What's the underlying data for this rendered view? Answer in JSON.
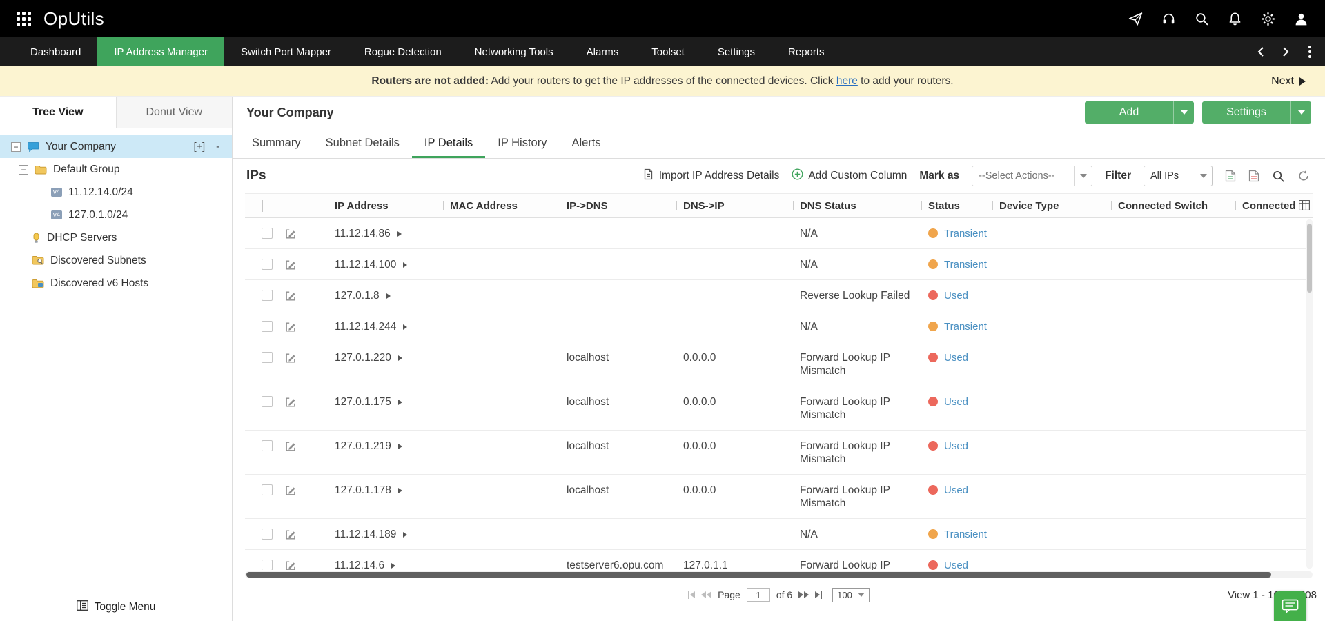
{
  "colors": {
    "accent_green": "#3fa45c",
    "button_green": "#53ae68",
    "banner_bg": "#fcf4d1",
    "tree_selected_bg": "#cde9f7",
    "status_link_text": "#4a90c2",
    "status": {
      "Transient": "#f0a54c",
      "Used": "#ec685c"
    }
  },
  "topbar": {
    "logo": "OpUtils",
    "icons": [
      "apps-grid-icon",
      "announcement-icon",
      "support-icon",
      "search-icon",
      "notifications-icon",
      "settings-gear-icon",
      "user-icon"
    ]
  },
  "nav": {
    "items": [
      {
        "label": "Dashboard"
      },
      {
        "label": "IP Address Manager",
        "active": true
      },
      {
        "label": "Switch Port Mapper"
      },
      {
        "label": "Rogue Detection"
      },
      {
        "label": "Networking Tools"
      },
      {
        "label": "Alarms"
      },
      {
        "label": "Toolset"
      },
      {
        "label": "Settings"
      },
      {
        "label": "Reports"
      }
    ]
  },
  "banner": {
    "bold": "Routers are not added:",
    "before_link": " Add your routers to get the IP addresses of the connected devices. Click ",
    "link": "here",
    "after_link": " to add your routers.",
    "next_label": "Next"
  },
  "sidebar": {
    "tabs": [
      {
        "label": "Tree View",
        "active": true
      },
      {
        "label": "Donut View"
      }
    ],
    "tree": [
      {
        "label": "Your Company",
        "icon": "company-icon"
      },
      {
        "label": "Default Group",
        "icon": "folder-icon"
      },
      {
        "label": "11.12.14.0/24",
        "icon": "v4-badge"
      },
      {
        "label": "127.0.1.0/24",
        "icon": "v4-badge"
      },
      {
        "label": "DHCP Servers",
        "icon": "dhcp-server-icon"
      },
      {
        "label": "Discovered Subnets",
        "icon": "folder-search-icon"
      },
      {
        "label": "Discovered v6 Hosts",
        "icon": "folder-v6-icon"
      }
    ],
    "tree_controls": {
      "add": "[+]",
      "remove": "-"
    },
    "toggle_menu": "Toggle Menu"
  },
  "main": {
    "title": "Your Company",
    "add_button": "Add",
    "settings_button": "Settings",
    "tabs": [
      {
        "label": "Summary"
      },
      {
        "label": "Subnet Details"
      },
      {
        "label": "IP Details",
        "active": true
      },
      {
        "label": "IP History"
      },
      {
        "label": "Alerts"
      }
    ],
    "section_title": "IPs",
    "toolbar": {
      "import_label": "Import IP Address Details",
      "add_column_label": "Add Custom Column",
      "mark_as_label": "Mark as",
      "actions_dropdown": "--Select Actions--",
      "filter_label": "Filter",
      "filter_dropdown": "All IPs",
      "icons": [
        "export-csv-icon",
        "export-pdf-icon",
        "search-icon",
        "refresh-icon"
      ]
    },
    "table": {
      "columns": [
        "IP Address",
        "MAC Address",
        "IP->DNS",
        "DNS->IP",
        "DNS Status",
        "Status",
        "Device Type",
        "Connected Switch",
        "Connected"
      ],
      "rows": [
        {
          "ip": "11.12.14.86",
          "mac": "",
          "ip_dns": "",
          "dns_ip": "",
          "dns_status": "N/A",
          "status": "Transient",
          "device_type": "",
          "connected_switch": ""
        },
        {
          "ip": "11.12.14.100",
          "mac": "",
          "ip_dns": "",
          "dns_ip": "",
          "dns_status": "N/A",
          "status": "Transient",
          "device_type": "",
          "connected_switch": ""
        },
        {
          "ip": "127.0.1.8",
          "mac": "",
          "ip_dns": "",
          "dns_ip": "",
          "dns_status": "Reverse Lookup Failed",
          "status": "Used",
          "device_type": "",
          "connected_switch": ""
        },
        {
          "ip": "11.12.14.244",
          "mac": "",
          "ip_dns": "",
          "dns_ip": "",
          "dns_status": "N/A",
          "status": "Transient",
          "device_type": "",
          "connected_switch": ""
        },
        {
          "ip": "127.0.1.220",
          "mac": "",
          "ip_dns": "localhost",
          "dns_ip": "0.0.0.0",
          "dns_status": "Forward Lookup IP Mismatch",
          "status": "Used",
          "device_type": "",
          "connected_switch": ""
        },
        {
          "ip": "127.0.1.175",
          "mac": "",
          "ip_dns": "localhost",
          "dns_ip": "0.0.0.0",
          "dns_status": "Forward Lookup IP Mismatch",
          "status": "Used",
          "device_type": "",
          "connected_switch": ""
        },
        {
          "ip": "127.0.1.219",
          "mac": "",
          "ip_dns": "localhost",
          "dns_ip": "0.0.0.0",
          "dns_status": "Forward Lookup IP Mismatch",
          "status": "Used",
          "device_type": "",
          "connected_switch": ""
        },
        {
          "ip": "127.0.1.178",
          "mac": "",
          "ip_dns": "localhost",
          "dns_ip": "0.0.0.0",
          "dns_status": "Forward Lookup IP Mismatch",
          "status": "Used",
          "device_type": "",
          "connected_switch": ""
        },
        {
          "ip": "11.12.14.189",
          "mac": "",
          "ip_dns": "",
          "dns_ip": "",
          "dns_status": "N/A",
          "status": "Transient",
          "device_type": "",
          "connected_switch": ""
        },
        {
          "ip": "11.12.14.6",
          "mac": "",
          "ip_dns": "testserver6.opu.com",
          "dns_ip": "127.0.1.1",
          "dns_status": "Forward Lookup IP Mismatch",
          "status": "Used",
          "device_type": "",
          "connected_switch": ""
        }
      ]
    },
    "pagination": {
      "page_label": "Page",
      "current_page": "1",
      "of_label": "of 6",
      "page_size": "100",
      "view_label": "View 1 - 100 of 508"
    }
  }
}
